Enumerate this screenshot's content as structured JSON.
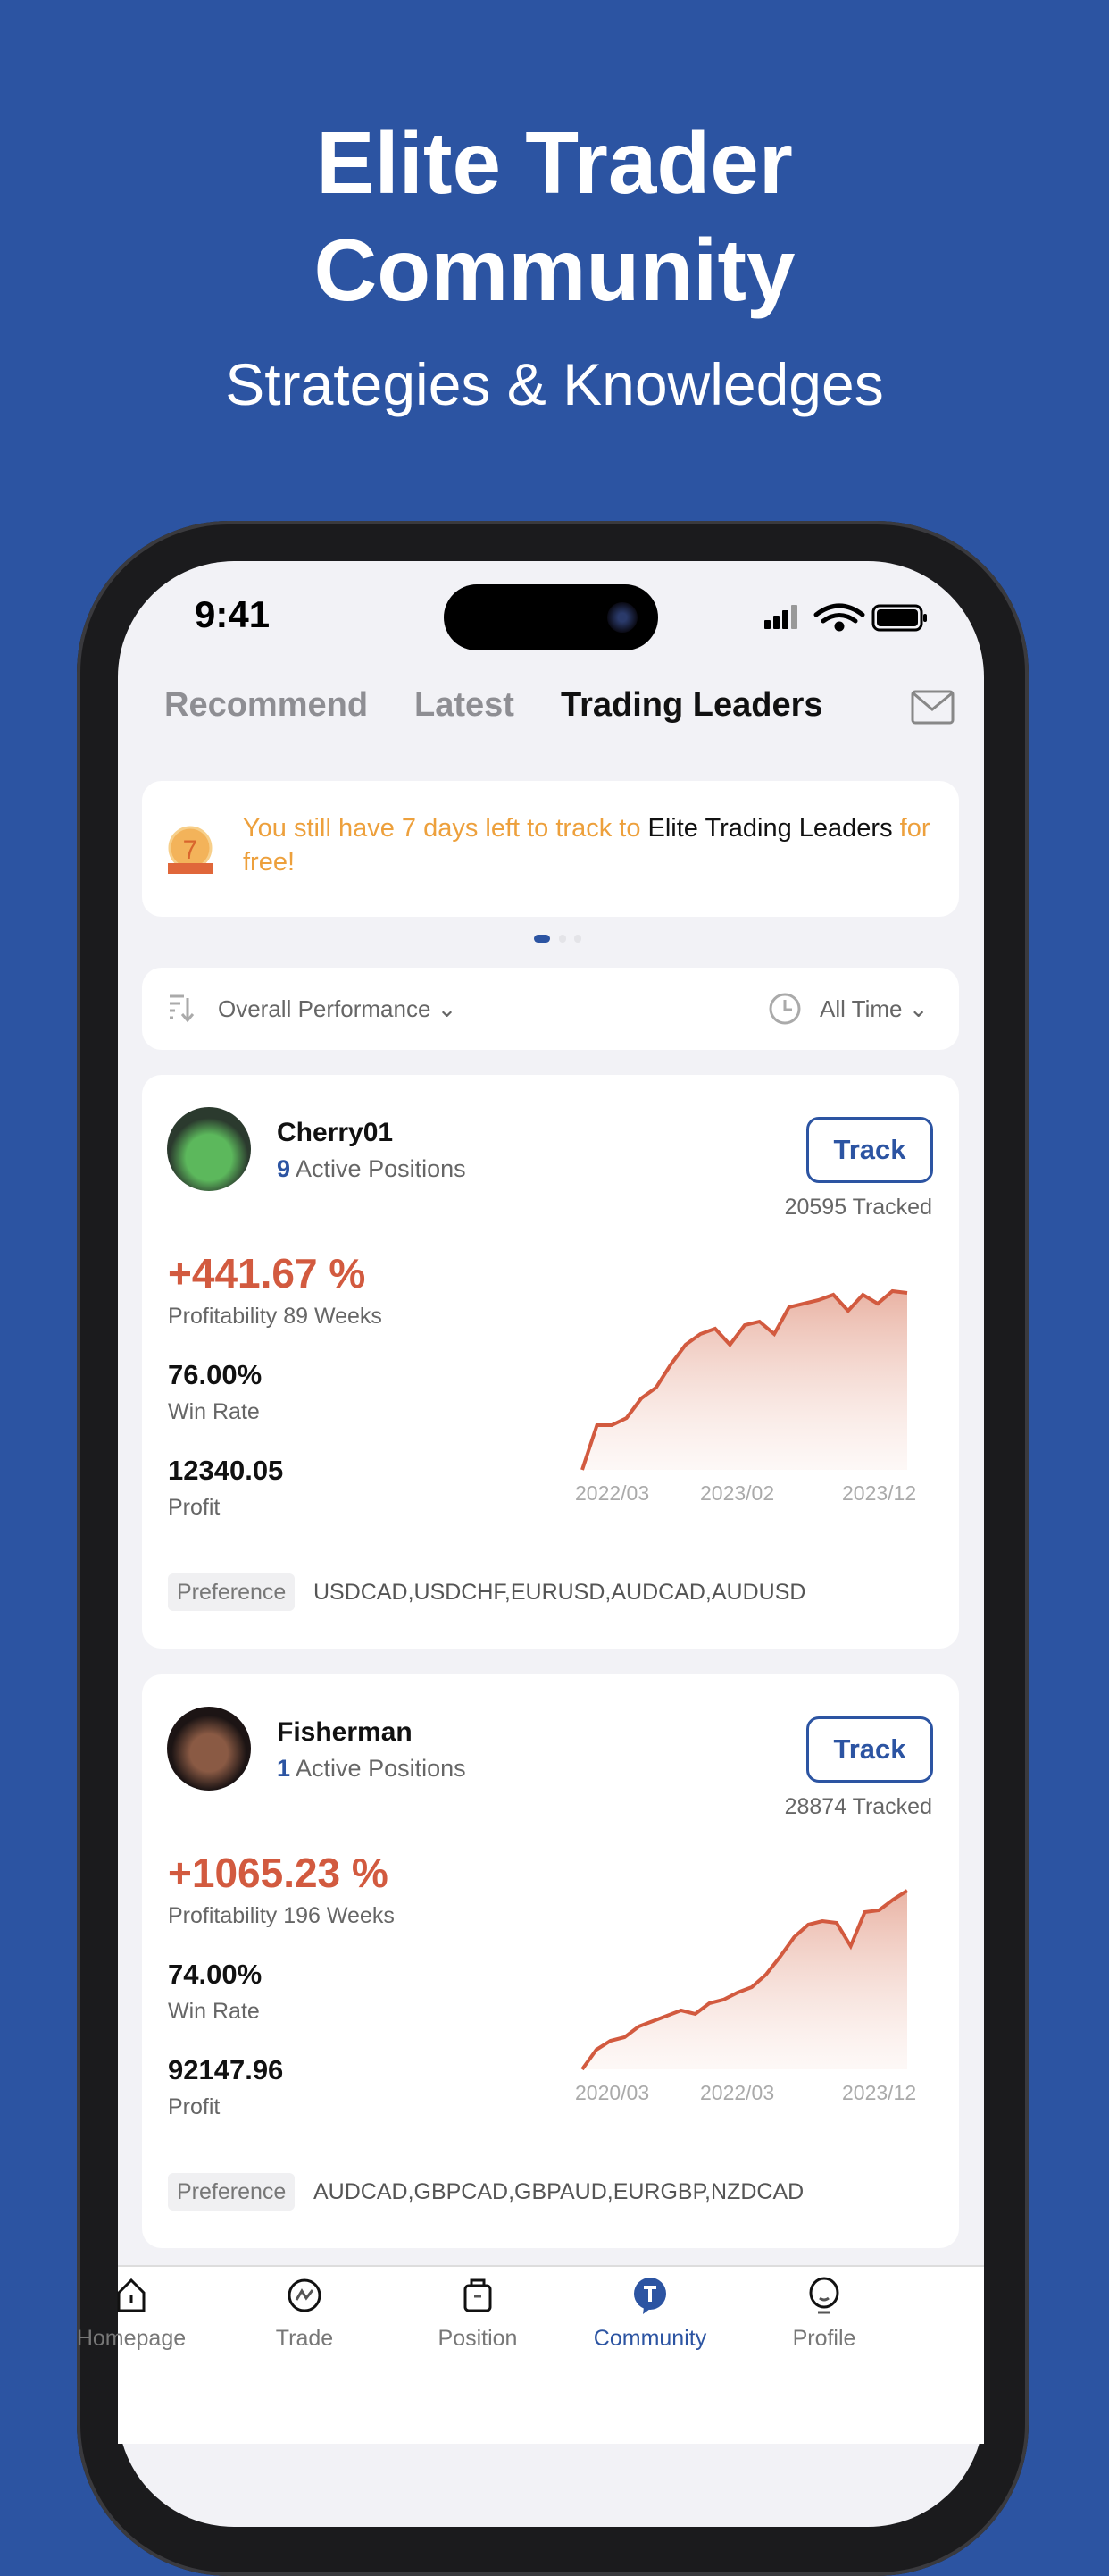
{
  "hero": {
    "title_line1": "Elite Trader",
    "title_line2": "Community",
    "subtitle": "Strategies & Knowledges"
  },
  "status": {
    "time": "9:41"
  },
  "tabs": [
    {
      "label": "Recommend"
    },
    {
      "label": "Latest"
    },
    {
      "label": "Trading Leaders",
      "active": true
    }
  ],
  "banner": {
    "badge": "7",
    "text_highlight": "You still have 7 days left to track to ",
    "text_link": "Elite Trading Leaders",
    "text_end": " for free!",
    "page_dots": 3,
    "active_dot": 0
  },
  "filters": {
    "sort": "Overall Performance",
    "period": "All Time"
  },
  "colors": {
    "accent": "#2c54a2",
    "profit": "#d25a3f",
    "banner": "#eda03c"
  },
  "cards": [
    {
      "name": "Cherry01",
      "active_count": "9",
      "active_label": " Active Positions",
      "track_label": "Track",
      "tracked": "20595 Tracked",
      "profitability": "+441.67 %",
      "profit_period": "Profitability  89 Weeks",
      "win_rate": "76.00%",
      "win_rate_label": "Win Rate",
      "profit": "12340.05",
      "profit_label": "Profit",
      "preference_label": "Preference",
      "preference": "USDCAD,USDCHF,EURUSD,AUDCAD,AUDUSD",
      "chart_data": {
        "type": "area",
        "x_ticks": [
          "2022/03",
          "2023/02",
          "2023/12"
        ],
        "values": [
          0,
          25,
          25,
          29,
          40,
          46,
          59,
          70,
          76,
          79,
          70,
          81,
          83,
          76,
          91,
          93,
          95,
          98,
          89,
          98,
          93,
          100,
          99
        ]
      }
    },
    {
      "name": "Fisherman",
      "active_count": "1",
      "active_label": " Active Positions",
      "track_label": "Track",
      "tracked": "28874 Tracked",
      "profitability": "+1065.23 %",
      "profit_period": "Profitability  196 Weeks",
      "win_rate": "74.00%",
      "win_rate_label": "Win Rate",
      "profit": "92147.96",
      "profit_label": "Profit",
      "preference_label": "Preference",
      "preference": "AUDCAD,GBPCAD,GBPAUD,EURGBP,NZDCAD",
      "chart_data": {
        "type": "area",
        "x_ticks": [
          "2020/03",
          "2022/03",
          "2023/12"
        ],
        "values": [
          0,
          11,
          16,
          18,
          24,
          27,
          30,
          33,
          31,
          37,
          39,
          43,
          46,
          53,
          63,
          74,
          81,
          83,
          82,
          69,
          88,
          89,
          95,
          100
        ]
      }
    }
  ],
  "nav": [
    {
      "label": "Homepage",
      "icon": "home-icon"
    },
    {
      "label": "Trade",
      "icon": "trade-icon"
    },
    {
      "label": "Position",
      "icon": "briefcase-icon"
    },
    {
      "label": "Community",
      "icon": "community-icon",
      "active": true
    },
    {
      "label": "Profile",
      "icon": "profile-icon"
    }
  ]
}
